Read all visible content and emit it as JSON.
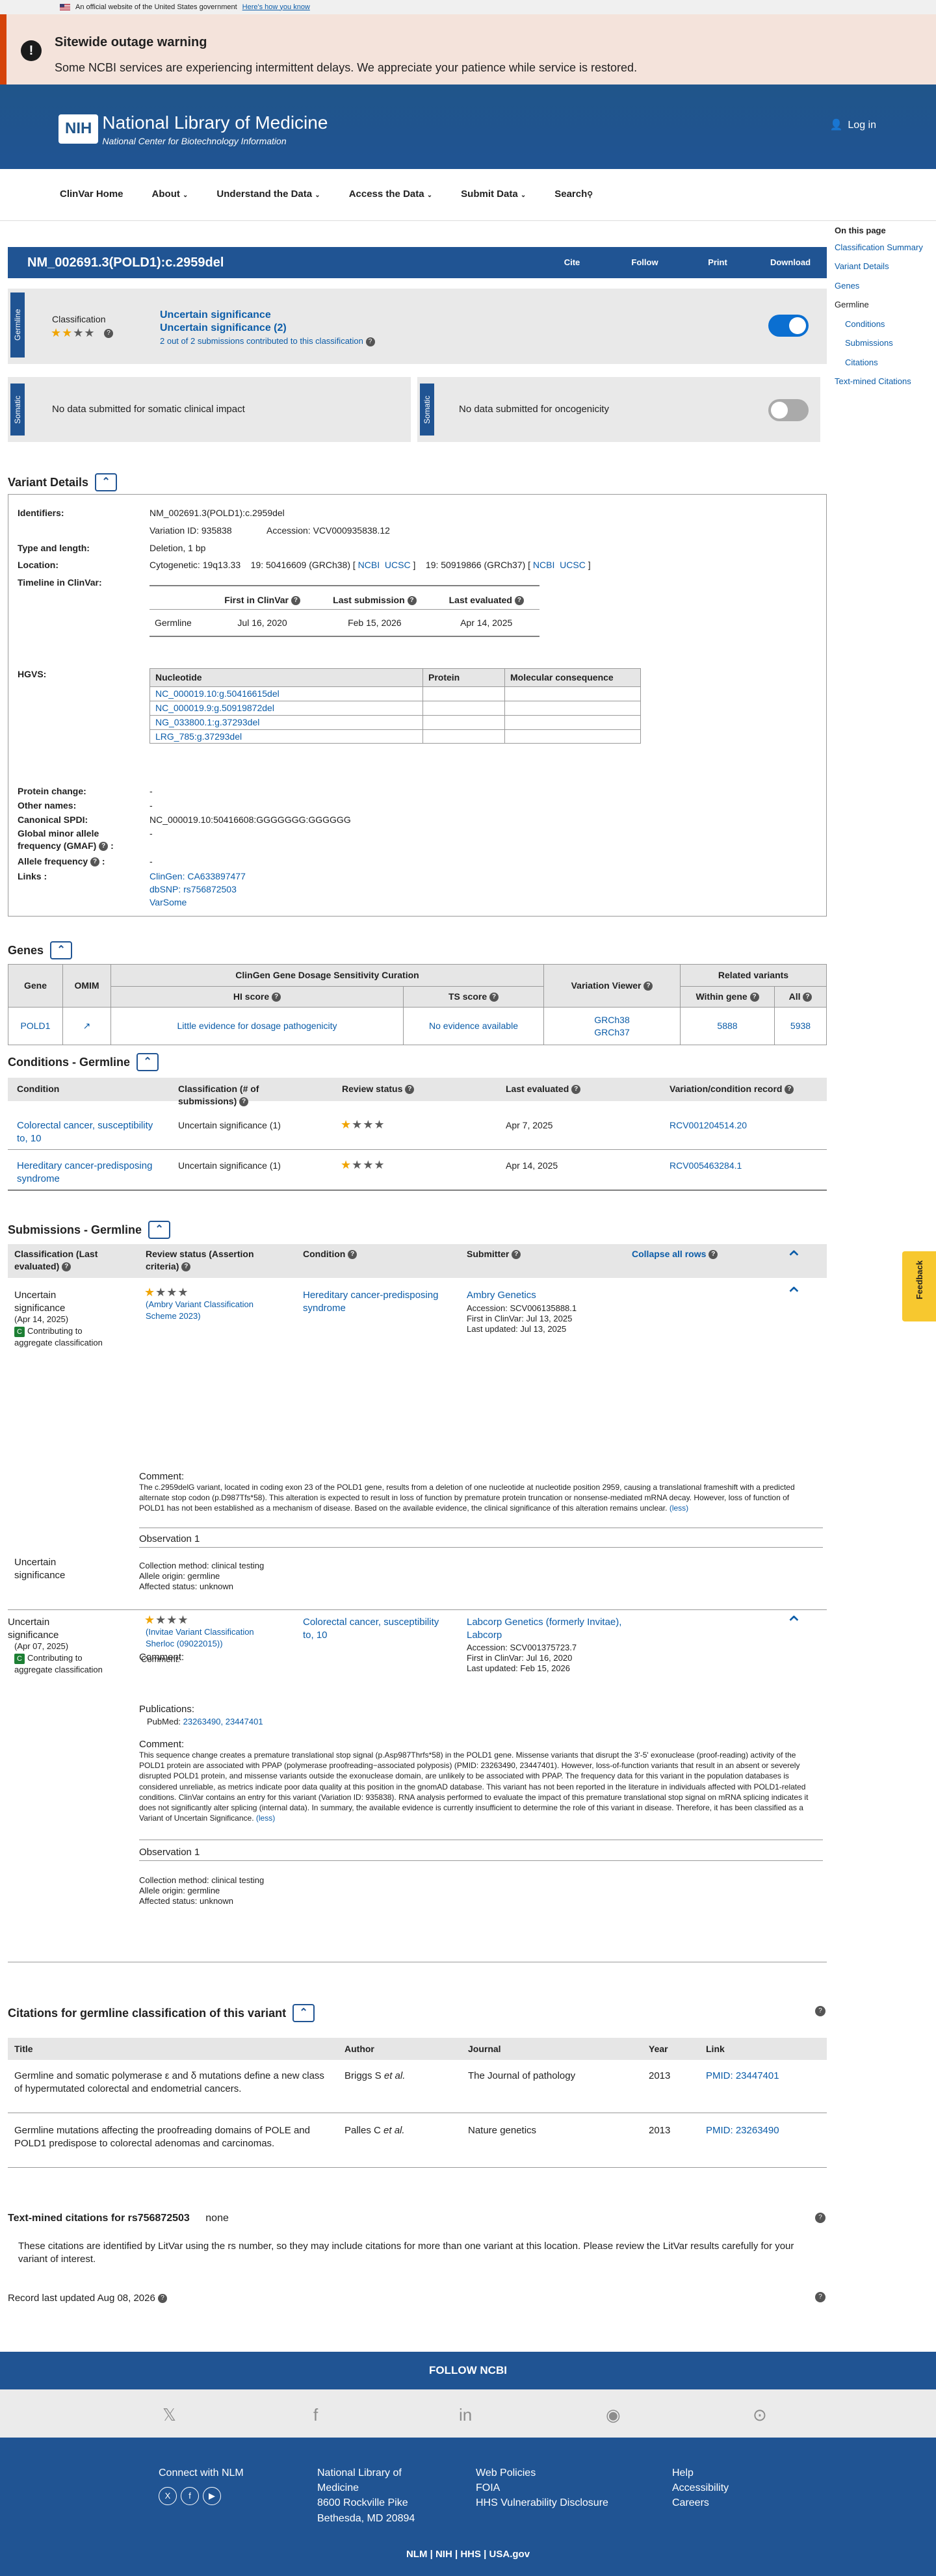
{
  "gov": {
    "text": "An official website of the United States government",
    "how": "Here's how you know"
  },
  "alert": {
    "title": "Sitewide outage warning",
    "text": "Some NCBI services are experiencing intermittent delays. We appreciate your patience while service is restored."
  },
  "header": {
    "nih": "NIH",
    "title": "National Library of Medicine",
    "subtitle": "National Center for Biotechnology Information",
    "login": "Log in"
  },
  "menu": {
    "items": [
      "ClinVar Home",
      "About",
      "Understand the Data",
      "Access the Data",
      "Submit Data",
      "Search"
    ]
  },
  "sidebar": {
    "title": "On this page",
    "items": [
      "Classification Summary",
      "Variant Details",
      "Genes",
      "Germline",
      "Conditions",
      "Submissions",
      "Citations",
      "Text-mined Citations"
    ]
  },
  "title": {
    "text": "NM_002691.3(POLD1):c.2959del",
    "actions": [
      "Cite",
      "Follow",
      "Print",
      "Download"
    ]
  },
  "germline": {
    "tag": "Germline",
    "label": "Classification",
    "sig1": "Uncertain significance",
    "sig2": "Uncertain significance (2)",
    "subs": "2 out of 2 submissions contributed to this classification"
  },
  "somatic": {
    "tag": "Somatic",
    "left": "No data submitted for somatic clinical impact",
    "right": "No data submitted for oncogenicity"
  },
  "variant": {
    "heading": "Variant Details",
    "labels": {
      "identifiers": "Identifiers:",
      "type": "Type and length:",
      "location": "Location:",
      "timeline": "Timeline in ClinVar:",
      "hgvs": "HGVS:",
      "protein": "Protein change:",
      "other": "Other names:",
      "spdi": "Canonical SPDI:",
      "gmaf": "Global minor allele frequency (GMAF)",
      "af": "Allele frequency",
      "links": "Links :"
    },
    "id": "NM_002691.3(POLD1):c.2959del",
    "variation_id": "Variation ID: 935838",
    "accession": "Accession: VCV000935838.12",
    "type": "Deletion, 1 bp",
    "cyto": "Cytogenetic: 19q13.33",
    "grch38": "19: 50416609 (GRCh38) [",
    "grch37": "19: 50919866 (GRCh37) [",
    "ncbi": "NCBI",
    "ucsc": "UCSC",
    "close": "]",
    "timeline_head": [
      "First in ClinVar",
      "Last submission",
      "Last evaluated"
    ],
    "timeline_row": [
      "Germline",
      "Jul 16, 2020",
      "Feb 15, 2026",
      "Apr 14, 2025"
    ],
    "hgvs_head": [
      "Nucleotide",
      "Protein",
      "Molecular consequence"
    ],
    "hgvs_rows": [
      "NC_000019.10:g.50416615del",
      "NC_000019.9:g.50919872del",
      "NG_033800.1:g.37293del",
      "LRG_785:g.37293del"
    ],
    "protein": "-",
    "other": "-",
    "spdi": "NC_000019.10:50416608:GGGGGGG:GGGGGG",
    "gmaf_val": "-",
    "af_val": "-",
    "links": [
      "ClinGen: CA633897477",
      "dbSNP: rs756872503",
      "VarSome"
    ]
  },
  "genes": {
    "heading": "Genes",
    "curation": "ClinGen Gene Dosage Sensitivity Curation",
    "related": "Related variants",
    "heads": [
      "Gene",
      "OMIM",
      "HI score",
      "TS score",
      "Variation Viewer",
      "Within gene",
      "All"
    ],
    "row": {
      "gene": "POLD1",
      "hi": "Little evidence for dosage pathogenicity",
      "ts": "No evidence available",
      "v1": "GRCh38",
      "v2": "GRCh37",
      "within": "5888",
      "all": "5938"
    }
  },
  "conditions": {
    "heading": "Conditions - Germline",
    "heads": [
      "Condition",
      "Classification (# of submissions)",
      "Review status",
      "Last evaluated",
      "Variation/condition record"
    ],
    "rows": [
      {
        "cond": "Colorectal cancer, susceptibility to, 10",
        "cls": "Uncertain significance (1)",
        "date": "Apr 7, 2025",
        "rec": "RCV001204514.20"
      },
      {
        "cond": "Hereditary cancer-predisposing syndrome",
        "cls": "Uncertain significance (1)",
        "date": "Apr 14, 2025",
        "rec": "RCV005463284.1"
      }
    ]
  },
  "submissions": {
    "heading": "Submissions - Germline",
    "heads": {
      "cls": "Classification (Last evaluated)",
      "rev": "Review status (Assertion criteria)",
      "cond": "Condition",
      "sub": "Submitter",
      "collapse": "Collapse all rows"
    },
    "contrib": "Contributing to aggregate classification",
    "comment": "Comment:",
    "obs": "Observation 1",
    "pubs": "Publications:",
    "pubmed": "PubMed:",
    "pmids": "23263490, 23447401",
    "s1": {
      "cls": "Uncertain significance",
      "date": "(Apr 14, 2025)",
      "crit": "(Ambry Variant Classification Scheme 2023)",
      "cond": "Hereditary cancer-predisposing syndrome",
      "submitter": "Ambry Genetics",
      "acc": "Accession: SCV006135888.1",
      "first": "First in ClinVar: Jul 13, 2025",
      "updated": "Last updated: Jul 13, 2025",
      "comment": "The c.2959delG variant, located in coding exon 23 of the POLD1 gene, results from a deletion of one nucleotide at nucleotide position 2959, causing a translational frameshift with a predicted alternate stop codon (p.D987Tfs*58). This alteration is expected to result in loss of function by premature protein truncation or nonsense-mediated mRNA decay. However, loss of function of POLD1 has not been established as a mechanism of disease. Based on the available evidence, the clinical significance of this alteration remains unclear.",
      "less": "(less)",
      "obs": [
        "Collection method: clinical testing",
        "Allele origin: germline",
        "Affected status: unknown"
      ]
    },
    "s2": {
      "cls": "Uncertain significance",
      "date": "(Apr 07, 2025)",
      "crit": "(Invitae Variant Classification Sherloc (09022015))",
      "cond": "Colorectal cancer, susceptibility to, 10",
      "submitter": "Labcorp Genetics (formerly Invitae), Labcorp",
      "acc": "Accession: SCV001375723.7",
      "first": "First in ClinVar: Jul 16, 2020",
      "updated": "Last updated: Feb 15, 2026",
      "comment": "This sequence change creates a premature translational stop signal (p.Asp987Thrfs*58) in the POLD1 gene. Missense variants that disrupt the 3'-5' exonuclease (proof-reading) activity of the POLD1 protein are associated with PPAP (polymerase proofreading−associated polyposis) (PMID: 23263490, 23447401). However, loss-of-function variants that result in an absent or severely disrupted POLD1 protein, and missense variants outside the exonuclease domain, are unlikely to be associated with PPAP. The frequency data for this variant in the population databases is considered unreliable, as metrics indicate poor data quality at this position in the gnomAD database. This variant has not been reported in the literature in individuals affected with POLD1-related conditions. ClinVar contains an entry for this variant (Variation ID: 935838). RNA analysis performed to evaluate the impact of this premature translational stop signal on mRNA splicing indicates it does not significantly alter splicing (internal data). In summary, the available evidence is currently insufficient to determine the role of this variant in disease. Therefore, it has been classified as a Variant of Uncertain Significance.",
      "less": "(less)",
      "obs": [
        "Collection method: clinical testing",
        "Allele origin: germline",
        "Affected status: unknown"
      ]
    }
  },
  "citations": {
    "heading": "Citations for germline classification of this variant",
    "heads": [
      "Title",
      "Author",
      "Journal",
      "Year",
      "Link"
    ],
    "rows": [
      {
        "title": "Germline and somatic polymerase ε and δ mutations define a new class of hypermutated colorectal and endometrial cancers.",
        "author": "Briggs S",
        "etal": "et al.",
        "journal": "The Journal of pathology",
        "year": "2013",
        "link": "PMID: 23447401"
      },
      {
        "title": "Germline mutations affecting the proofreading domains of POLE and POLD1 predispose to colorectal adenomas and carcinomas.",
        "author": "Palles C",
        "etal": "et al.",
        "journal": "Nature genetics",
        "year": "2013",
        "link": "PMID: 23263490"
      }
    ]
  },
  "textmined": {
    "heading": "Text-mined citations for rs756872503",
    "none": "none",
    "text": "These citations are identified by LitVar using the rs number, so they may include citations for more than one variant at this location. Please review the LitVar results carefully for your variant of interest."
  },
  "record": "Record last updated Aug 08, 2026",
  "feedback": "Feedback",
  "footer": {
    "follow": "FOLLOW NCBI",
    "connect": "Connect with NLM",
    "nlm": [
      "National Library of",
      "Medicine",
      "8600 Rockville Pike",
      "Bethesda, MD 20894"
    ],
    "col3": [
      "Web Policies",
      "FOIA",
      "HHS Vulnerability Disclosure"
    ],
    "col4": [
      "Help",
      "Accessibility",
      "Careers"
    ],
    "bottom": "NLM  |  NIH  |  HHS  |  USA.gov"
  }
}
